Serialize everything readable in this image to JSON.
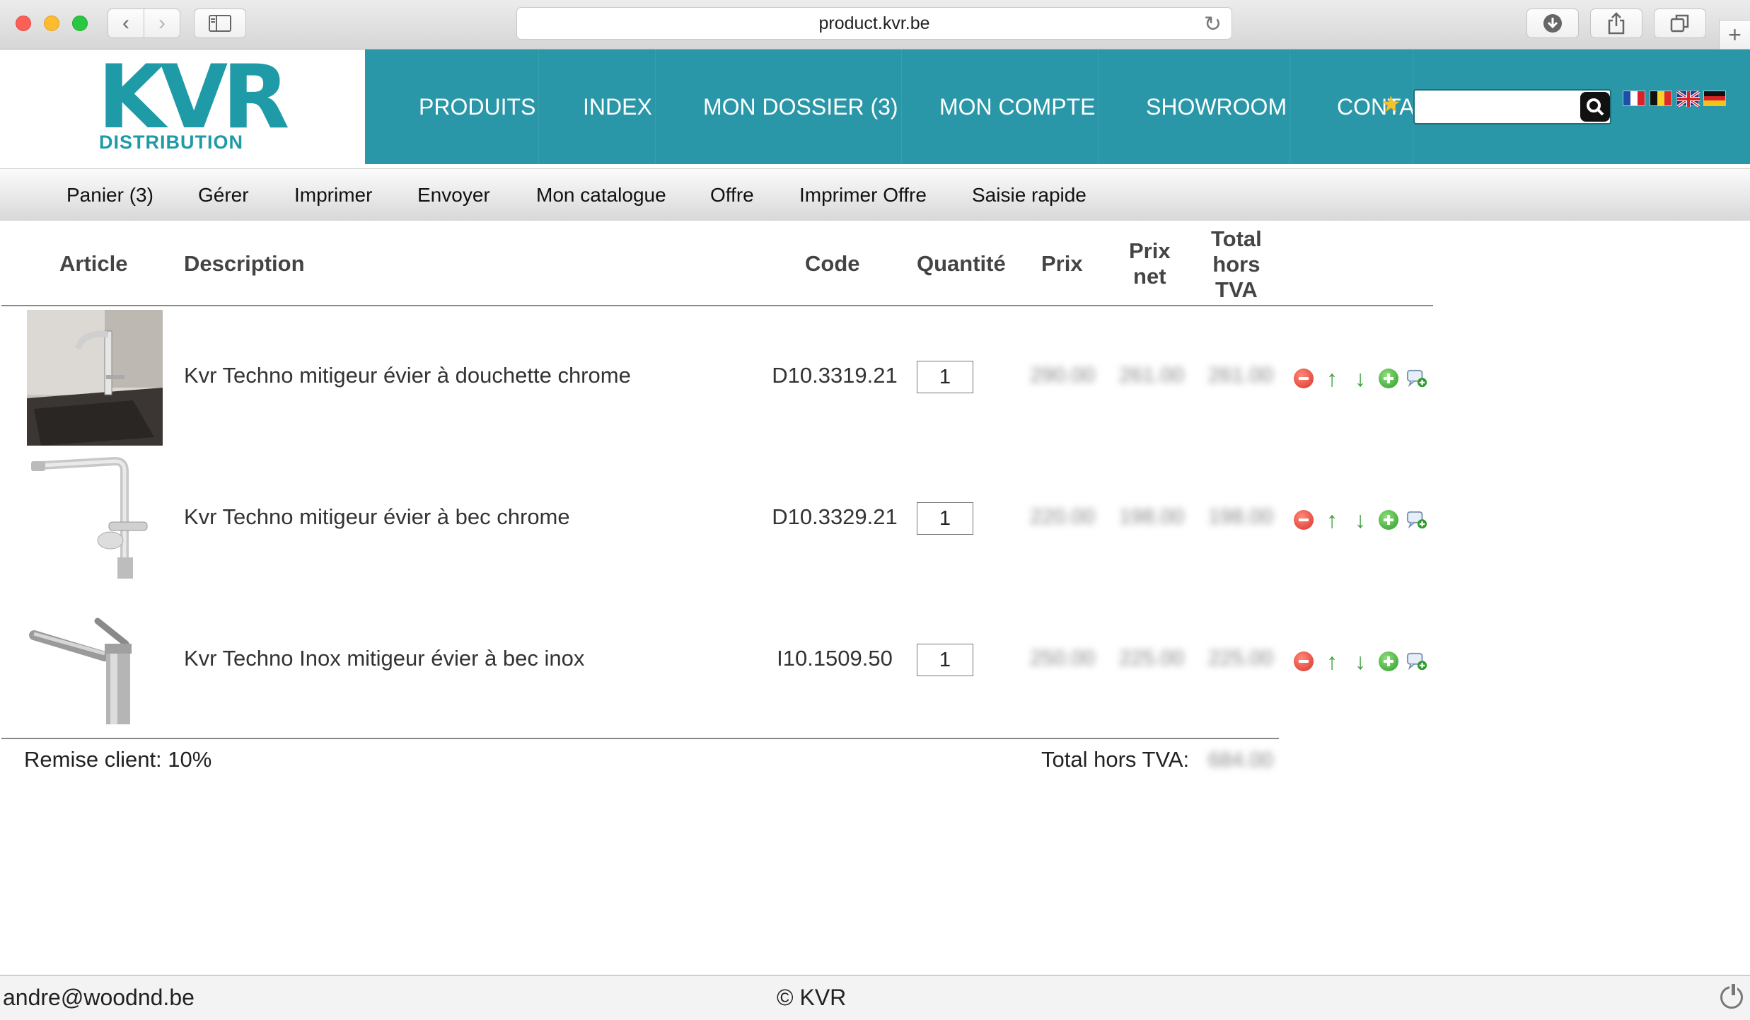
{
  "browser": {
    "url": "product.kvr.be"
  },
  "logo": {
    "main": "KVR",
    "sub": "DISTRIBUTION"
  },
  "nav": [
    {
      "label": "PRODUITS"
    },
    {
      "label": "INDEX"
    },
    {
      "label": "MON DOSSIER (3)"
    },
    {
      "label": "MON COMPTE"
    },
    {
      "label": "SHOWROOM"
    },
    {
      "label": "CONTA"
    }
  ],
  "search": {
    "value": ""
  },
  "submenu": [
    {
      "label": "Panier (3)"
    },
    {
      "label": "Gérer"
    },
    {
      "label": "Imprimer"
    },
    {
      "label": "Envoyer"
    },
    {
      "label": "Mon catalogue"
    },
    {
      "label": "Offre"
    },
    {
      "label": "Imprimer Offre"
    },
    {
      "label": "Saisie rapide"
    }
  ],
  "table": {
    "headers": {
      "article": "Article",
      "description": "Description",
      "code": "Code",
      "quantite": "Quantité",
      "prix": "Prix",
      "prix_net_1": "Prix",
      "prix_net_2": "net",
      "total_1": "Total",
      "total_2": "hors",
      "total_3": "TVA"
    },
    "rows": [
      {
        "description": "Kvr Techno mitigeur évier à douchette chrome",
        "code": "D10.3319.21",
        "qty": "1",
        "prix": "290.00",
        "prix_net": "261.00",
        "total": "261.00"
      },
      {
        "description": "Kvr Techno mitigeur évier à bec chrome",
        "code": "D10.3329.21",
        "qty": "1",
        "prix": "220.00",
        "prix_net": "198.00",
        "total": "198.00"
      },
      {
        "description": "Kvr Techno Inox mitigeur évier à bec inox",
        "code": "I10.1509.50",
        "qty": "1",
        "prix": "250.00",
        "prix_net": "225.00",
        "total": "225.00"
      }
    ]
  },
  "summary": {
    "remise": "Remise client: 10%",
    "total_label": "Total hors TVA:",
    "total_value": "684.00"
  },
  "footer": {
    "email": "andre@woodnd.be",
    "copyright": "© KVR"
  }
}
